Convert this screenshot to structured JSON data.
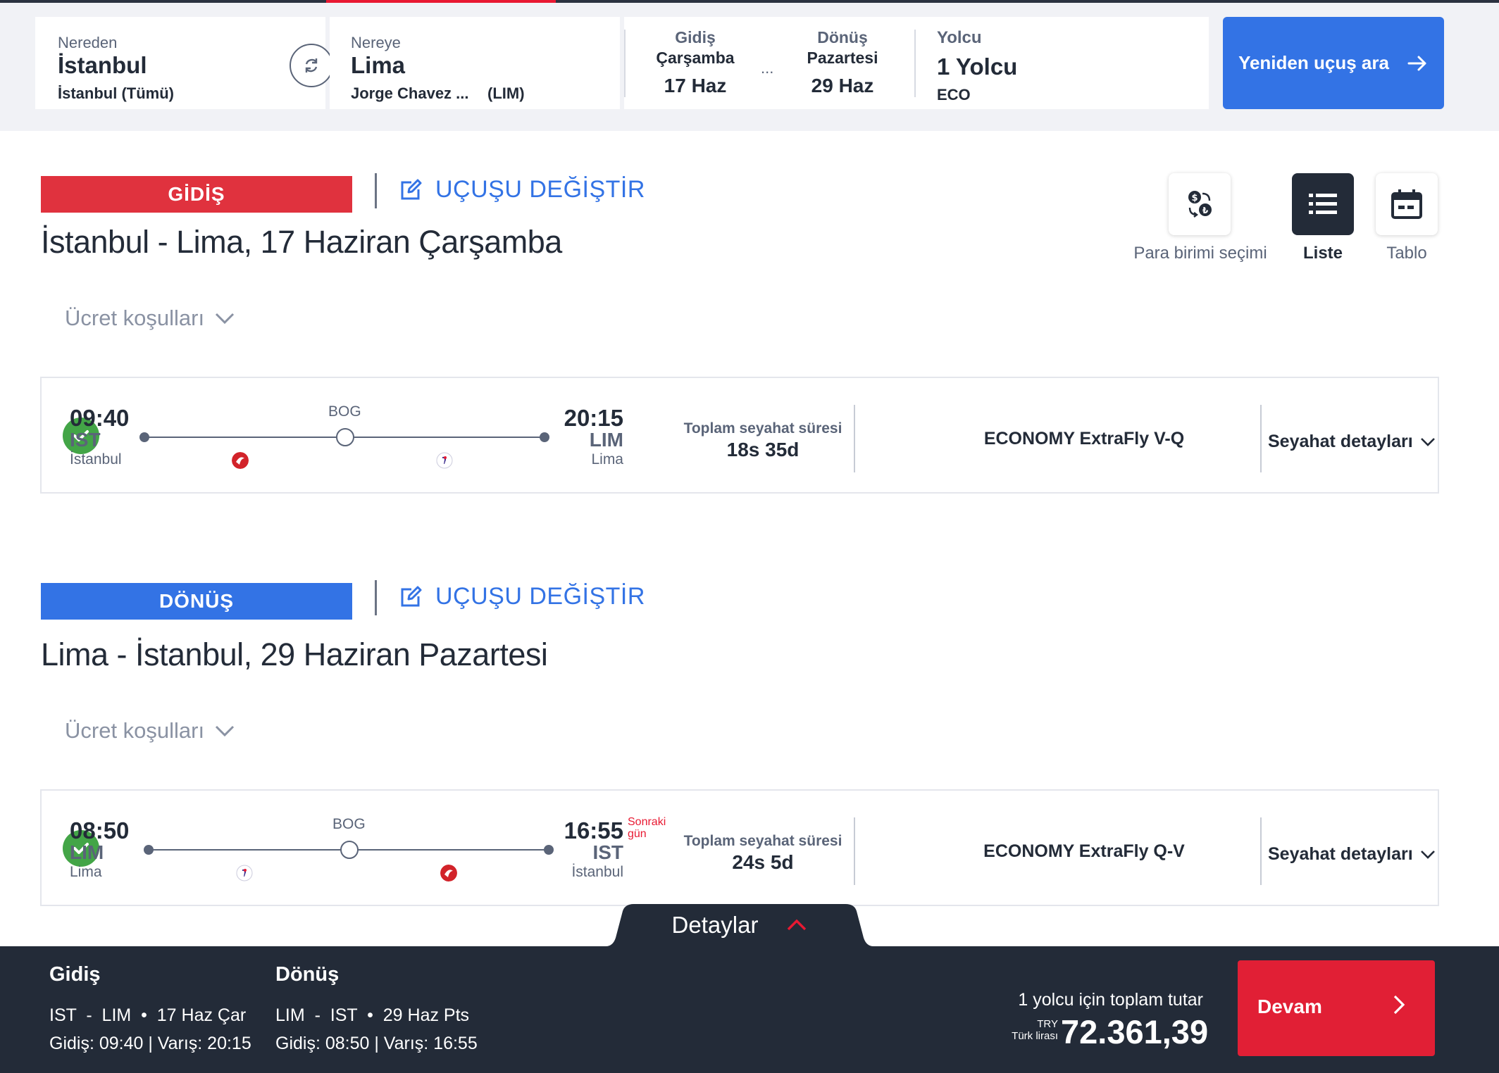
{
  "search": {
    "from_label": "Nereden",
    "from_city": "İstanbul",
    "from_sub": "İstanbul (Tümü)",
    "to_label": "Nereye",
    "to_city": "Lima",
    "to_sub_airport": "Jorge Chavez ...",
    "to_sub_code": "(LIM)",
    "dep_label": "Gidiş",
    "dep_day": "Çarşamba",
    "dep_date": "17 Haz",
    "dots": "...",
    "ret_label": "Dönüş",
    "ret_day": "Pazartesi",
    "ret_date": "29 Haz",
    "pax_label": "Yolcu",
    "pax_value": "1 Yolcu",
    "cabin": "ECO",
    "search_button": "Yeniden uçuş ara"
  },
  "tools": {
    "currency": "Para birimi seçimi",
    "list": "Liste",
    "table": "Tablo"
  },
  "outbound": {
    "banner": "GİDİŞ",
    "change": "UÇUŞU DEĞİŞTİR",
    "title": "İstanbul - Lima, 17 Haziran Çarşamba",
    "fare_conditions": "Ücret koşulları",
    "dep_time": "09:40",
    "dep_code": "IST",
    "dep_city": "İstanbul",
    "stop": "BOG",
    "arr_time": "20:15",
    "arr_code": "LIM",
    "arr_city": "Lima",
    "duration_label": "Toplam seyahat süresi",
    "duration": "18s 35d",
    "fare_class": "ECONOMY ExtraFly V-Q",
    "details": "Seyahat detayları"
  },
  "inbound": {
    "banner": "DÖNÜŞ",
    "change": "UÇUŞU DEĞİŞTİR",
    "title": "Lima - İstanbul, 29 Haziran Pazartesi",
    "fare_conditions": "Ücret koşulları",
    "dep_time": "08:50",
    "dep_code": "LIM",
    "dep_city": "Lima",
    "stop": "BOG",
    "arr_time": "16:55",
    "next_day_1": "Sonraki",
    "next_day_2": "gün",
    "arr_code": "IST",
    "arr_city": "İstanbul",
    "duration_label": "Toplam seyahat süresi",
    "duration": "24s 5d",
    "fare_class": "ECONOMY ExtraFly Q-V",
    "details": "Seyahat detayları"
  },
  "summary": {
    "tab": "Detaylar",
    "out_head": "Gidiş",
    "out_route": "IST  -  LIM  •  17 Haz Çar",
    "out_times": "Gidiş: 09:40 | Varış: 20:15",
    "in_head": "Dönüş",
    "in_route": "LIM  -  IST  •  29 Haz Pts",
    "in_times": "Gidiş: 08:50 | Varış: 16:55",
    "total_label": "1 yolcu için toplam tutar",
    "currency_code": "TRY",
    "currency_name": "Türk lirası",
    "total": "72.361,39",
    "continue": "Devam"
  },
  "colors": {
    "brand_red": "#e81932",
    "brand_blue": "#3373e5",
    "dark": "#232b38",
    "success": "#43a547"
  }
}
